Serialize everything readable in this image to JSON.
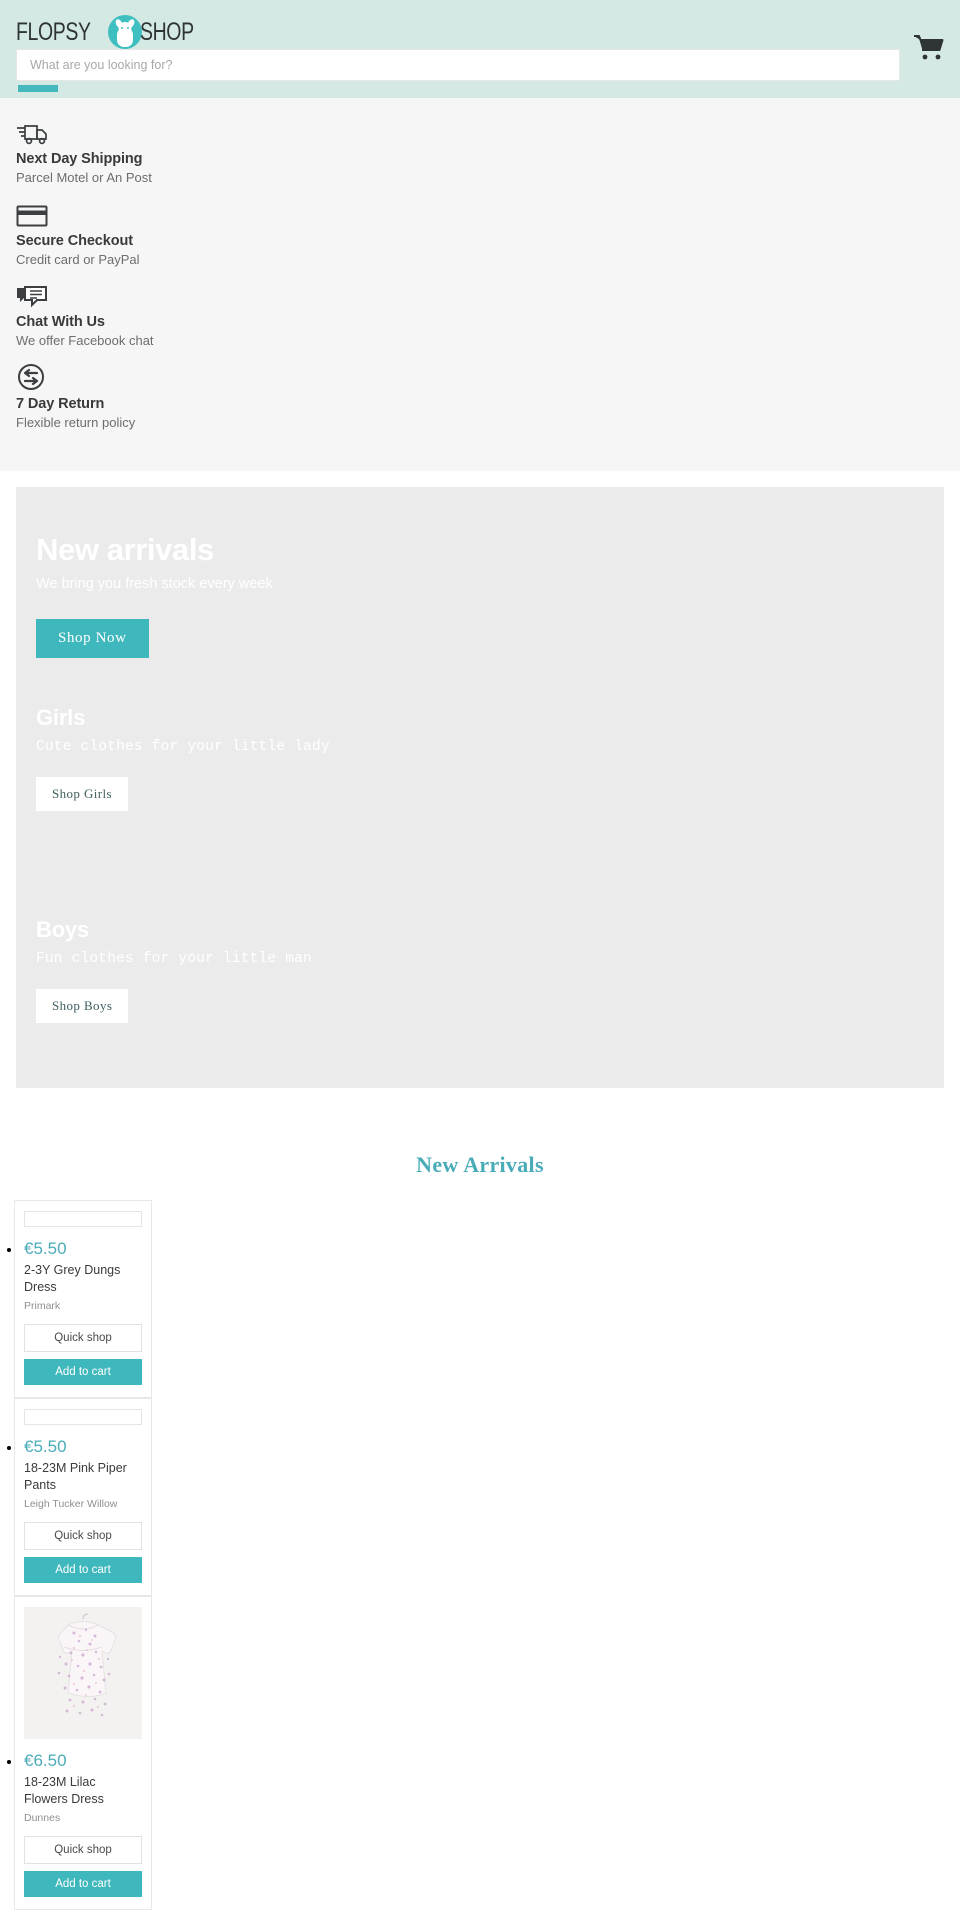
{
  "header": {
    "logo_text_left": "FLOPSY",
    "logo_text_right": "SHOP",
    "logo_icon": "bunny-badge-icon",
    "cart_icon": "shopping-cart-icon",
    "accent_color": "#3fb8bd",
    "header_bg": "#d4e9e4"
  },
  "search": {
    "placeholder": "What are you looking for?",
    "value": ""
  },
  "benefits": [
    {
      "icon": "delivery-truck-icon",
      "title": "Next Day Shipping",
      "subtitle": "Parcel Motel or An Post"
    },
    {
      "icon": "credit-card-icon",
      "title": "Secure Checkout",
      "subtitle": "Credit card or PayPal"
    },
    {
      "icon": "chat-bubbles-icon",
      "title": "Chat With Us",
      "subtitle": "We offer Facebook chat"
    },
    {
      "icon": "return-arrows-icon",
      "title": "7 Day Return",
      "subtitle": "Flexible return policy"
    }
  ],
  "promos": [
    {
      "title": "New arrivals",
      "subtitle": "We bring you fresh stock every week",
      "button": "Shop Now",
      "style": "teal"
    },
    {
      "title": "Girls",
      "subtitle": "Cute clothes for your little lady",
      "button": "Shop Girls",
      "style": "white"
    },
    {
      "title": "Boys",
      "subtitle": "Fun clothes for your little man",
      "button": "Shop Boys",
      "style": "white"
    }
  ],
  "arrivals": {
    "heading": "New Arrivals",
    "quick_shop_label": "Quick shop",
    "add_to_cart_label": "Add to cart",
    "products": [
      {
        "price": "€5.50",
        "name": "2-3Y Grey Dungs Dress",
        "brand": "Primark",
        "has_image": false
      },
      {
        "price": "€5.50",
        "name": "18-23M Pink Piper Pants",
        "brand": "Leigh Tucker Willow",
        "has_image": false
      },
      {
        "price": "€6.50",
        "name": "18-23M Lilac Flowers Dress",
        "brand": "Dunnes",
        "has_image": true,
        "image_alt": "lilac floral long-sleeve dress on hanger"
      }
    ]
  }
}
